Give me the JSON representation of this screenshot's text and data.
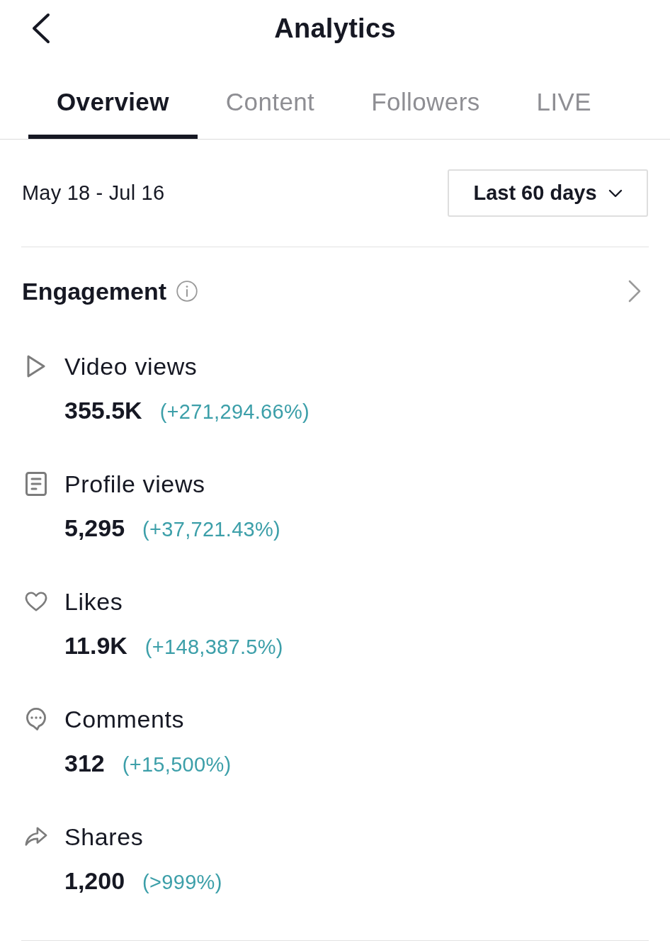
{
  "header": {
    "title": "Analytics"
  },
  "tabs": [
    {
      "label": "Overview",
      "selected": true
    },
    {
      "label": "Content",
      "selected": false
    },
    {
      "label": "Followers",
      "selected": false
    },
    {
      "label": "LIVE",
      "selected": false
    }
  ],
  "date_range": {
    "text": "May 18 - Jul 16",
    "period": "Last 60 days"
  },
  "engagement": {
    "title": "Engagement",
    "metrics": [
      {
        "kind": "play",
        "label": "Video views",
        "value": "355.5K",
        "change": "(+271,294.66%)"
      },
      {
        "kind": "profile",
        "label": "Profile views",
        "value": "5,295",
        "change": "(+37,721.43%)"
      },
      {
        "kind": "heart",
        "label": "Likes",
        "value": "11.9K",
        "change": "(+148,387.5%)"
      },
      {
        "kind": "comment",
        "label": "Comments",
        "value": "312",
        "change": "(+15,500%)"
      },
      {
        "kind": "share",
        "label": "Shares",
        "value": "1,200",
        "change": "(>999%)"
      }
    ]
  }
}
